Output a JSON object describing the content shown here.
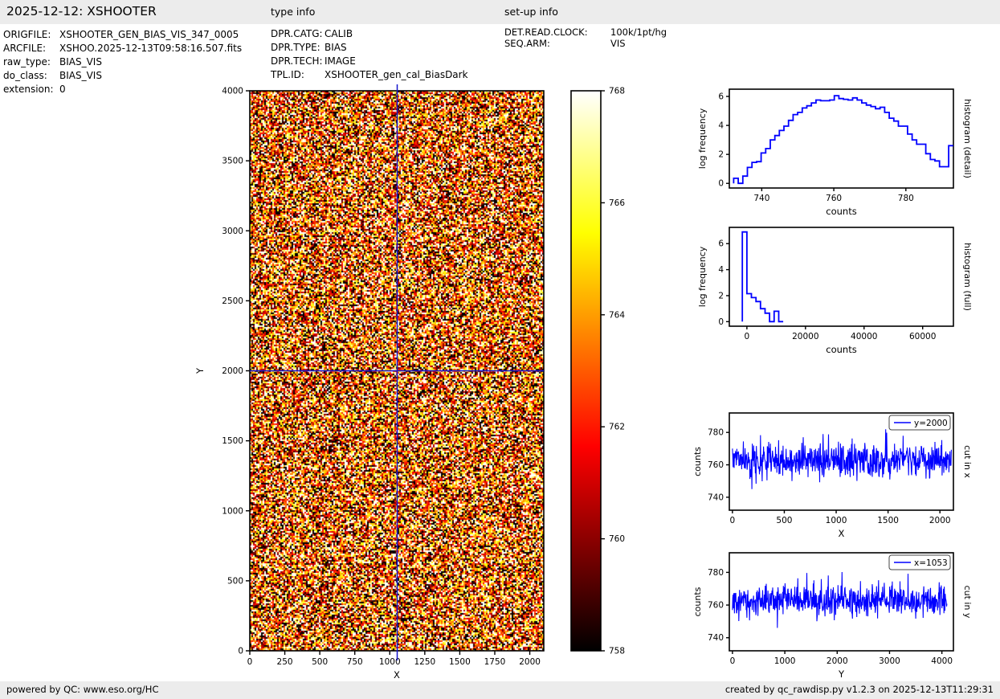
{
  "header": {
    "title": "2025-12-12: XSHOOTER",
    "type_info_heading": "type info",
    "setup_info_heading": "set-up info"
  },
  "file_info": [
    {
      "label": "ORIGFILE:",
      "value": "XSHOOTER_GEN_BIAS_VIS_347_0005"
    },
    {
      "label": "ARCFILE:",
      "value": "XSHOO.2025-12-13T09:58:16.507.fits"
    },
    {
      "label": "raw_type:",
      "value": "BIAS_VIS"
    },
    {
      "label": "do_class:",
      "value": "BIAS_VIS"
    },
    {
      "label": "extension:",
      "value": "0"
    }
  ],
  "type_info": [
    {
      "label": "DPR.CATG:",
      "value": "CALIB"
    },
    {
      "label": "DPR.TYPE:",
      "value": "BIAS"
    },
    {
      "label": "DPR.TECH:",
      "value": "IMAGE"
    },
    {
      "label": "TPL.ID:",
      "value": "XSHOOTER_gen_cal_BiasDark"
    }
  ],
  "setup_info": [
    {
      "label": "DET.READ.CLOCK:",
      "value": "100k/1pt/hg"
    },
    {
      "label": "SEQ.ARM:",
      "value": "VIS"
    }
  ],
  "footer": {
    "left": "powered by QC: www.eso.org/HC",
    "right": "created by qc_rawdisp.py v1.2.3 on 2025-12-13T11:29:31"
  },
  "colors": {
    "line_blue": "#0000ff",
    "crosshair_blue": "#1515cc",
    "chrome_gray": "#ececec",
    "colormap_stops": [
      "#ffffff",
      "#ffff00",
      "#ff0000",
      "#000000"
    ]
  },
  "chart_data": [
    {
      "id": "main_image",
      "type": "heatmap",
      "xlabel": "X",
      "ylabel": "Y",
      "xticks": [
        0,
        250,
        500,
        750,
        1000,
        1250,
        1500,
        1750,
        2000
      ],
      "yticks": [
        0,
        500,
        1000,
        1500,
        2000,
        2500,
        3000,
        3500,
        4000
      ],
      "xlim": [
        0,
        2100
      ],
      "ylim": [
        0,
        4000
      ],
      "colormap": "hot",
      "vmin": 758,
      "vmax": 768,
      "noise_mean": 763,
      "noise_sigma": 5,
      "crosshair_x": 1053,
      "crosshair_y": 2000
    },
    {
      "id": "colorbar",
      "type": "colorbar",
      "ticks": [
        768,
        766,
        764,
        762,
        760,
        758
      ],
      "vmin": 758,
      "vmax": 768
    },
    {
      "id": "histogram_detail",
      "type": "histogram-step",
      "title_right": "histogram (detail)",
      "xlabel": "counts",
      "ylabel": "log frequency",
      "xticks": [
        740,
        760,
        780
      ],
      "yticks": [
        0,
        2,
        4,
        6
      ],
      "xlim": [
        731,
        793.2
      ],
      "ylim": [
        -0.32,
        6.5
      ],
      "bin_start": 732.2,
      "bin_width": 1.27,
      "values": [
        0.35,
        0,
        0.5,
        1.1,
        1.45,
        1.5,
        2.1,
        2.4,
        3.0,
        3.3,
        3.65,
        3.95,
        4.35,
        4.75,
        4.9,
        5.2,
        5.35,
        5.55,
        5.75,
        5.7,
        5.7,
        5.75,
        6.05,
        5.85,
        5.8,
        5.75,
        5.9,
        5.75,
        5.55,
        5.4,
        5.3,
        5.15,
        5.25,
        4.9,
        4.5,
        4.3,
        3.95,
        3.95,
        3.4,
        3.0,
        2.7,
        2.7,
        2.05,
        1.65,
        1.55,
        1.15,
        1.15,
        2.6
      ]
    },
    {
      "id": "histogram_full",
      "type": "histogram-step",
      "title_right": "histogram (full)",
      "xlabel": "counts",
      "ylabel": "log frequency",
      "xticks": [
        0,
        20000,
        40000,
        60000
      ],
      "yticks": [
        0,
        2,
        4,
        6
      ],
      "xlim": [
        -6000,
        70500
      ],
      "ylim": [
        -0.35,
        7.25
      ],
      "bin_start": -1550,
      "bin_width": 1550,
      "values": [
        6.9,
        2.15,
        1.85,
        1.55,
        1.0,
        0.65,
        0,
        0.8,
        0
      ]
    },
    {
      "id": "cut_in_x",
      "type": "line-noise",
      "title_right": "cut in x",
      "xlabel": "X",
      "ylabel": "counts",
      "legend": "y=2000",
      "xticks": [
        0,
        500,
        1000,
        1500,
        2000
      ],
      "yticks": [
        740,
        760,
        780
      ],
      "xlim": [
        -30,
        2130
      ],
      "ylim": [
        732,
        792
      ],
      "x_start": 0,
      "x_end": 2110,
      "signal_mean": 763,
      "signal_sigma": 5,
      "signal_min": 745,
      "signal_max": 782
    },
    {
      "id": "cut_in_y",
      "type": "line-noise",
      "title_right": "cut in y",
      "xlabel": "Y",
      "ylabel": "counts",
      "legend": "x=1053",
      "xticks": [
        0,
        1000,
        2000,
        3000,
        4000
      ],
      "yticks": [
        740,
        760,
        780
      ],
      "xlim": [
        -60,
        4220
      ],
      "ylim": [
        732,
        792
      ],
      "x_start": 0,
      "x_end": 4096,
      "signal_mean": 763,
      "signal_sigma": 5,
      "signal_min": 746,
      "signal_max": 784
    }
  ]
}
